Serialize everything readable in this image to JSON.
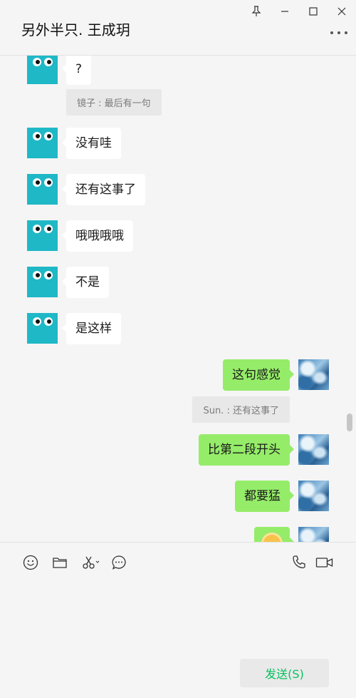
{
  "header": {
    "title": "另外半只. 王成玥"
  },
  "window_controls": {
    "pin_icon": "pin-icon",
    "minimize_icon": "minimize-icon",
    "maximize_icon": "maximize-icon",
    "close_icon": "close-icon"
  },
  "messages": [
    {
      "side": "left",
      "text": "?"
    },
    {
      "type": "quote",
      "text": "镜子 : 最后有一句"
    },
    {
      "side": "left",
      "text": "没有哇"
    },
    {
      "side": "left",
      "text": "还有这事了"
    },
    {
      "side": "left",
      "text": "哦哦哦哦"
    },
    {
      "side": "left",
      "text": "不是"
    },
    {
      "side": "left",
      "text": "是这样"
    },
    {
      "side": "right",
      "text": "这句感觉"
    },
    {
      "type": "quote",
      "text": "Sun. : 还有这事了"
    },
    {
      "side": "right",
      "text": "比第二段开头"
    },
    {
      "side": "right",
      "text": "都要猛"
    },
    {
      "side": "right",
      "emoji": "sun-face-emoji"
    }
  ],
  "toolbar": {
    "items": [
      "emoji-icon",
      "folder-icon",
      "scissors-icon",
      "chat-history-icon",
      "phone-icon",
      "video-icon"
    ]
  },
  "input": {
    "value": ""
  },
  "send_label": "发送(S)",
  "colors": {
    "background": "#f5f5f5",
    "self_bubble": "#95ec69",
    "other_bubble": "#ffffff",
    "quote_bg": "#e8e8e8",
    "avatar_teal": "#1fb8c6",
    "send_text": "#07c160"
  }
}
